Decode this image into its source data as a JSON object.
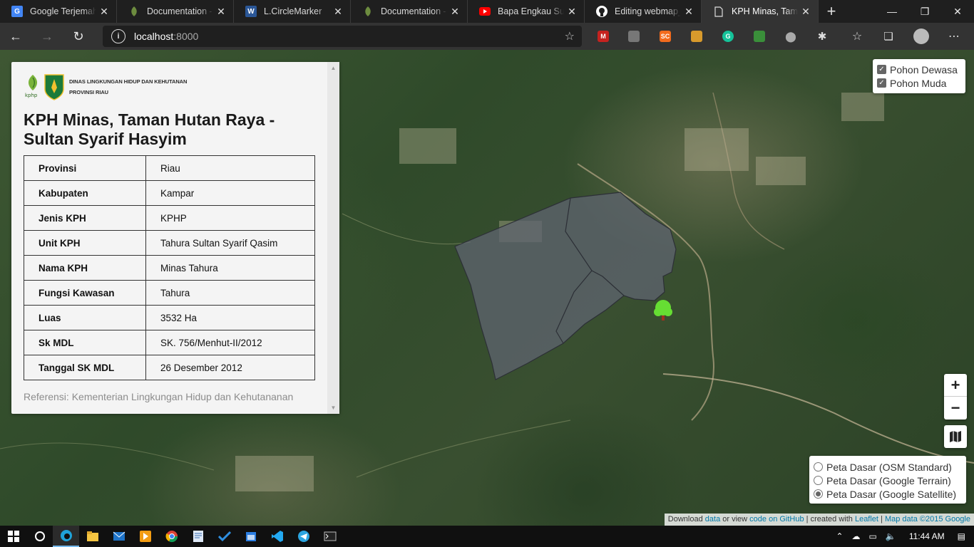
{
  "browser": {
    "tabs": [
      {
        "title": "Google Terjemahan",
        "icon": "google-translate-icon",
        "active": false
      },
      {
        "title": "Documentation - Leaflet",
        "icon": "leaflet-icon",
        "active": false
      },
      {
        "title": "L.CircleMarker",
        "icon": "word-icon",
        "active": false
      },
      {
        "title": "Documentation - Leaflet",
        "icon": "leaflet-icon",
        "active": false
      },
      {
        "title": "Bapa Engkau Sungguh Baik",
        "icon": "youtube-icon",
        "active": false
      },
      {
        "title": "Editing webmap_a",
        "icon": "github-icon",
        "active": false
      },
      {
        "title": "KPH Minas, Taman Hutan Raya",
        "icon": "page-icon",
        "active": true
      }
    ],
    "url_host": "localhost",
    "url_port": ":8000"
  },
  "panel": {
    "logo_line1": "DINAS LINGKUNGAN HIDUP DAN KEHUTANAN",
    "logo_line2": "PROVINSI RIAU",
    "logo_kphp": "kphp",
    "title": "KPH Minas, Taman Hutan Raya - Sultan Syarif Hasyim",
    "rows": [
      {
        "key": "Provinsi",
        "value": "Riau"
      },
      {
        "key": "Kabupaten",
        "value": "Kampar"
      },
      {
        "key": "Jenis KPH",
        "value": "KPHP"
      },
      {
        "key": "Unit KPH",
        "value": "Tahura Sultan Syarif Qasim"
      },
      {
        "key": "Nama KPH",
        "value": "Minas Tahura"
      },
      {
        "key": "Fungsi Kawasan",
        "value": "Tahura"
      },
      {
        "key": "Luas",
        "value": "3532 Ha"
      },
      {
        "key": "Sk MDL",
        "value": "SK. 756/Menhut-II/2012"
      },
      {
        "key": "Tanggal SK MDL",
        "value": "26 Desember 2012"
      }
    ],
    "reference": "Referensi: Kementerian Lingkungan Hidup dan Kehutananan"
  },
  "overlays": [
    {
      "label": "Pohon Dewasa",
      "checked": true
    },
    {
      "label": "Pohon Muda",
      "checked": true
    }
  ],
  "zoom": {
    "in": "+",
    "out": "−"
  },
  "base_layers": [
    {
      "label": "Peta Dasar (OSM Standard)",
      "selected": false
    },
    {
      "label": "Peta Dasar (Google Terrain)",
      "selected": false
    },
    {
      "label": "Peta Dasar (Google Satellite)",
      "selected": true
    }
  ],
  "attribution": {
    "t1": "Download ",
    "l1": "data",
    "t2": " or view ",
    "l2": "code on GitHub",
    "t3": " | created with ",
    "l3": "Leaflet",
    "t4": " | ",
    "l4": "Map data ©2015 Google"
  },
  "taskbar": {
    "time": "11:44 AM"
  },
  "colors": {
    "polygon_fill": "#5f6470",
    "marker": "#66dd33"
  }
}
